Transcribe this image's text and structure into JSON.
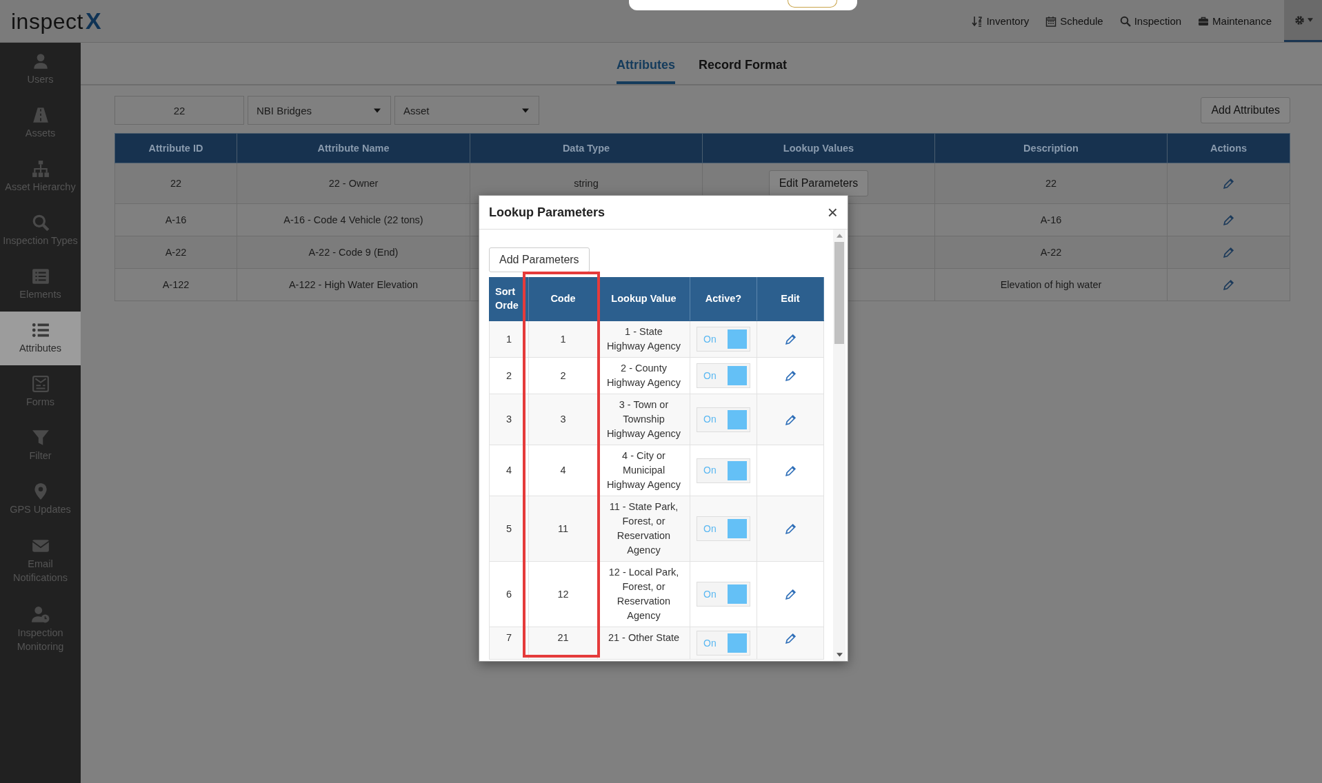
{
  "logo": {
    "text": "inspect",
    "mark": "X"
  },
  "nav": [
    {
      "label": "Inventory"
    },
    {
      "label": "Schedule"
    },
    {
      "label": "Inspection"
    },
    {
      "label": "Maintenance"
    }
  ],
  "sidebar": [
    {
      "label": "Users",
      "selected": false
    },
    {
      "label": "Assets",
      "selected": false
    },
    {
      "label": "Asset Hierarchy",
      "selected": false
    },
    {
      "label": "Inspection Types",
      "selected": false
    },
    {
      "label": "Elements",
      "selected": false
    },
    {
      "label": "Attributes",
      "selected": true
    },
    {
      "label": "Forms",
      "selected": false
    },
    {
      "label": "Filter",
      "selected": false
    },
    {
      "label": "GPS Updates",
      "selected": false
    },
    {
      "label": "Email Notifications",
      "selected": false
    },
    {
      "label": "Inspection Monitoring",
      "selected": false
    }
  ],
  "tabs": [
    {
      "label": "Attributes",
      "selected": true
    },
    {
      "label": "Record Format",
      "selected": false
    }
  ],
  "filters": {
    "id_value": "22",
    "dataset": "NBI Bridges",
    "level": "Asset"
  },
  "add_attributes": "Add Attributes",
  "table": {
    "columns": [
      "Attribute ID",
      "Attribute Name",
      "Data Type",
      "Lookup Values",
      "Description",
      "Actions"
    ],
    "rows": [
      {
        "id": "22",
        "name": "22 - Owner",
        "data_type": "string",
        "lookup": "Edit Parameters",
        "description": "22"
      },
      {
        "id": "A-16",
        "name": "A-16 - Code 4 Vehicle (22 tons)",
        "description": "A-16"
      },
      {
        "id": "A-22",
        "name": "A-22 - Code 9 (End)",
        "description": "A-22"
      },
      {
        "id": "A-122",
        "name": "A-122 - High Water Elevation",
        "description": "Elevation of high water"
      }
    ]
  },
  "modal": {
    "title": "Lookup Parameters",
    "close": "×",
    "add_button": "Add Parameters",
    "columns": [
      "Sort Orde",
      "Code",
      "Lookup Value",
      "Active?",
      "Edit"
    ],
    "rows": [
      {
        "sort": "1",
        "code": "1",
        "value": "1 - State Highway Agency",
        "active": true,
        "active_label": "On"
      },
      {
        "sort": "2",
        "code": "2",
        "value": "2 - County Highway Agency",
        "active": true,
        "active_label": "On"
      },
      {
        "sort": "3",
        "code": "3",
        "value": "3 - Town or Township Highway Agency",
        "active": true,
        "active_label": "On"
      },
      {
        "sort": "4",
        "code": "4",
        "value": "4 - City or Municipal Highway Agency",
        "active": true,
        "active_label": "On"
      },
      {
        "sort": "5",
        "code": "11",
        "value": "11 - State Park, Forest, or Reservation Agency",
        "active": true,
        "active_label": "On"
      },
      {
        "sort": "6",
        "code": "12",
        "value": "12 - Local Park, Forest, or Reservation Agency",
        "active": true,
        "active_label": "On"
      },
      {
        "sort": "7",
        "code": "21",
        "value": "21 - Other State",
        "active": true,
        "active_label": "On"
      }
    ]
  }
}
